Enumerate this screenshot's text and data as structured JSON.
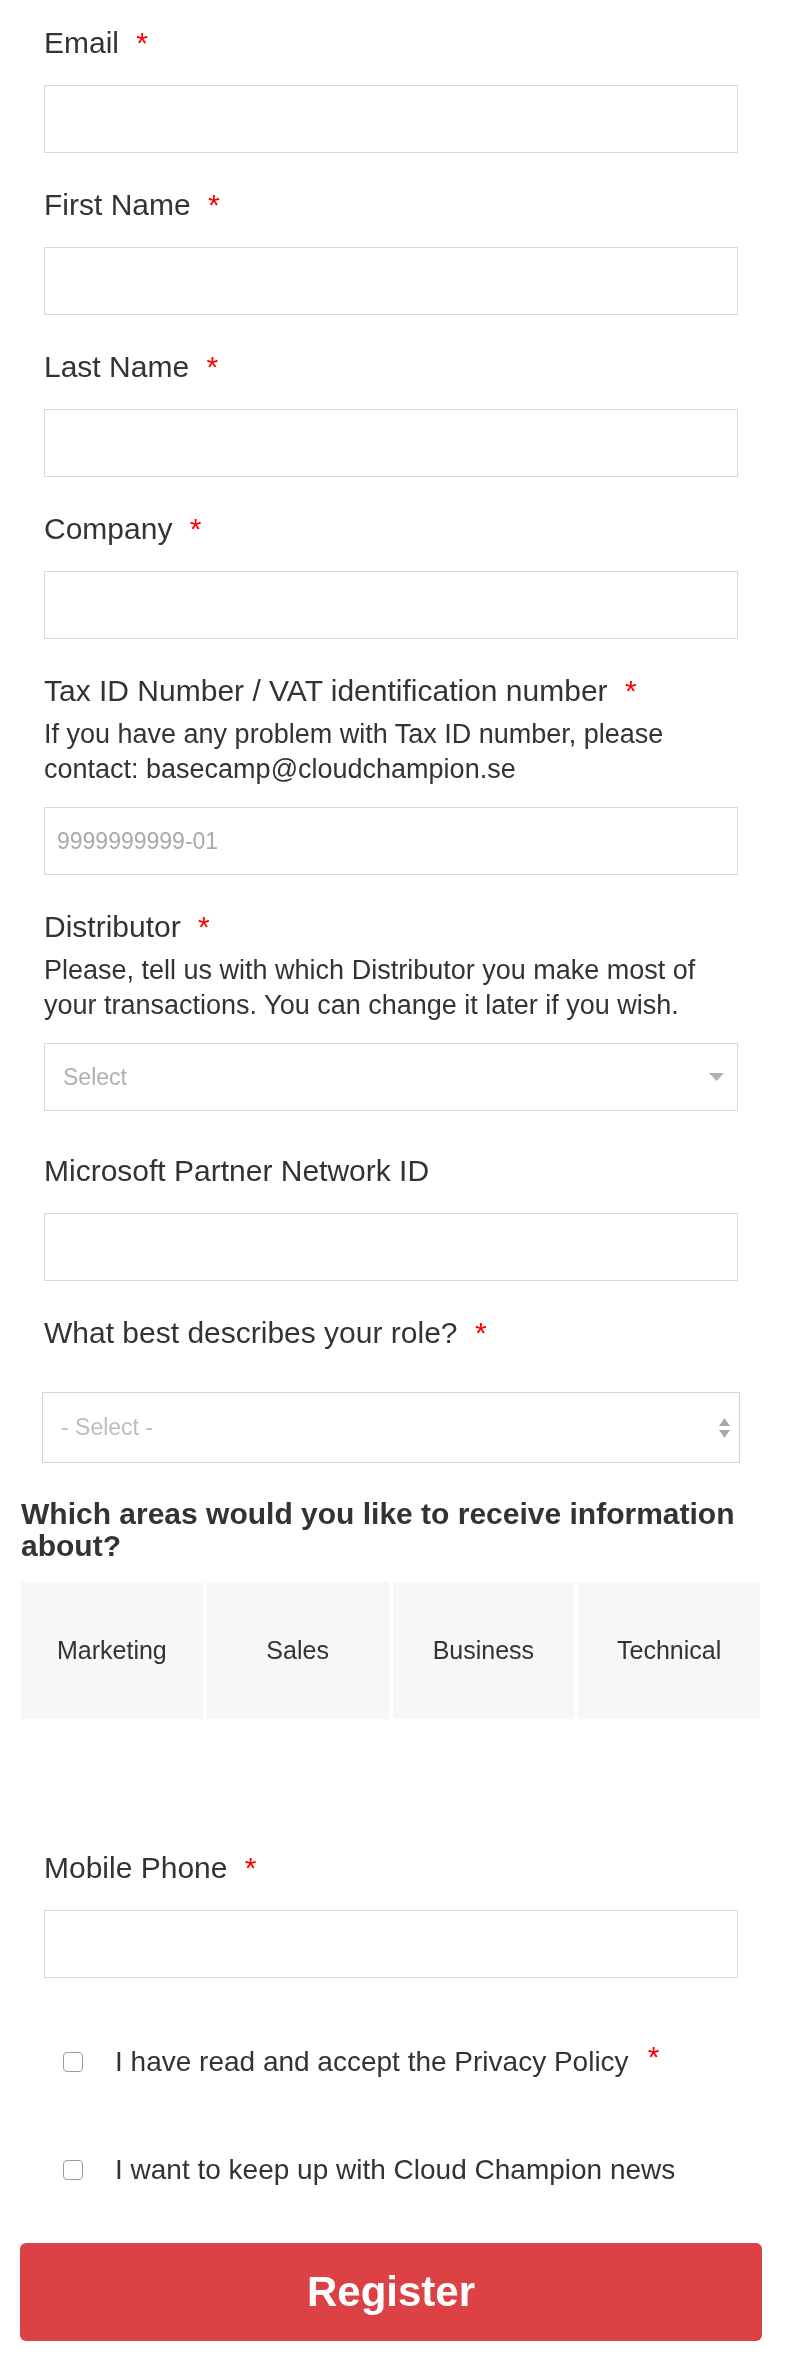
{
  "form_items": [
    {
      "kind": "text",
      "label": "Email",
      "required_mark": "*"
    },
    {
      "kind": "text",
      "label": "First Name",
      "required_mark": "*"
    },
    {
      "kind": "text",
      "label": "Last Name",
      "required_mark": "*"
    },
    {
      "kind": "text",
      "label": "Company",
      "required_mark": "*"
    },
    {
      "kind": "text",
      "label": "Tax ID Number / VAT identification number",
      "required_mark": "*",
      "help": "If you have any problem with Tax ID number, please contact: basecamp@cloudchampion.se",
      "placeholder": "9999999999-01"
    },
    {
      "kind": "select",
      "label": "Distributor",
      "required_mark": "*",
      "help": "Please, tell us with which Distributor you make most of your transactions. You can change it later if you wish.",
      "placeholder": "Select"
    },
    {
      "kind": "text",
      "label": "Microsoft Partner Network ID"
    },
    {
      "kind": "spin_select",
      "label": "What best describes your role?",
      "required_mark": "*",
      "placeholder": "- Select -"
    },
    {
      "kind": "tiles",
      "title": "Which areas would you like to receive information about?",
      "options": [
        {
          "label": "Marketing",
          "selected": false
        },
        {
          "label": "Sales",
          "selected": false
        },
        {
          "label": "Business",
          "selected": false
        },
        {
          "label": "Technical",
          "selected": false
        }
      ]
    },
    {
      "kind": "text",
      "label": "Mobile Phone",
      "required_mark": "*"
    }
  ],
  "consents": [
    {
      "label": "I have read and accept the Privacy Policy",
      "required_mark": "*",
      "checked": false
    },
    {
      "label": "I want to keep up with Cloud Champion news",
      "checked": false
    }
  ],
  "submit_button": {
    "label": "Register"
  }
}
